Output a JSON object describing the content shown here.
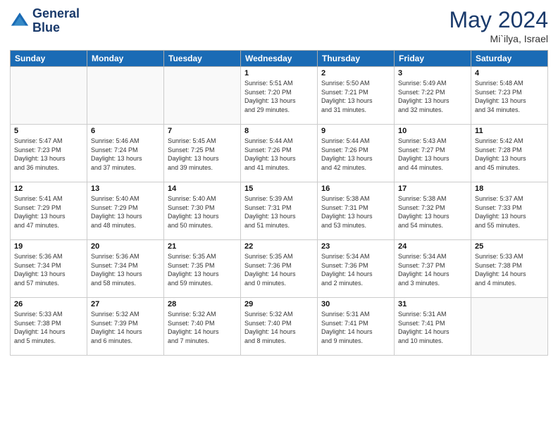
{
  "header": {
    "logo_line1": "General",
    "logo_line2": "Blue",
    "month": "May 2024",
    "location": "Mi`ilya, Israel"
  },
  "days_of_week": [
    "Sunday",
    "Monday",
    "Tuesday",
    "Wednesday",
    "Thursday",
    "Friday",
    "Saturday"
  ],
  "weeks": [
    [
      {
        "day": "",
        "info": ""
      },
      {
        "day": "",
        "info": ""
      },
      {
        "day": "",
        "info": ""
      },
      {
        "day": "1",
        "info": "Sunrise: 5:51 AM\nSunset: 7:20 PM\nDaylight: 13 hours\nand 29 minutes."
      },
      {
        "day": "2",
        "info": "Sunrise: 5:50 AM\nSunset: 7:21 PM\nDaylight: 13 hours\nand 31 minutes."
      },
      {
        "day": "3",
        "info": "Sunrise: 5:49 AM\nSunset: 7:22 PM\nDaylight: 13 hours\nand 32 minutes."
      },
      {
        "day": "4",
        "info": "Sunrise: 5:48 AM\nSunset: 7:23 PM\nDaylight: 13 hours\nand 34 minutes."
      }
    ],
    [
      {
        "day": "5",
        "info": "Sunrise: 5:47 AM\nSunset: 7:23 PM\nDaylight: 13 hours\nand 36 minutes."
      },
      {
        "day": "6",
        "info": "Sunrise: 5:46 AM\nSunset: 7:24 PM\nDaylight: 13 hours\nand 37 minutes."
      },
      {
        "day": "7",
        "info": "Sunrise: 5:45 AM\nSunset: 7:25 PM\nDaylight: 13 hours\nand 39 minutes."
      },
      {
        "day": "8",
        "info": "Sunrise: 5:44 AM\nSunset: 7:26 PM\nDaylight: 13 hours\nand 41 minutes."
      },
      {
        "day": "9",
        "info": "Sunrise: 5:44 AM\nSunset: 7:26 PM\nDaylight: 13 hours\nand 42 minutes."
      },
      {
        "day": "10",
        "info": "Sunrise: 5:43 AM\nSunset: 7:27 PM\nDaylight: 13 hours\nand 44 minutes."
      },
      {
        "day": "11",
        "info": "Sunrise: 5:42 AM\nSunset: 7:28 PM\nDaylight: 13 hours\nand 45 minutes."
      }
    ],
    [
      {
        "day": "12",
        "info": "Sunrise: 5:41 AM\nSunset: 7:29 PM\nDaylight: 13 hours\nand 47 minutes."
      },
      {
        "day": "13",
        "info": "Sunrise: 5:40 AM\nSunset: 7:29 PM\nDaylight: 13 hours\nand 48 minutes."
      },
      {
        "day": "14",
        "info": "Sunrise: 5:40 AM\nSunset: 7:30 PM\nDaylight: 13 hours\nand 50 minutes."
      },
      {
        "day": "15",
        "info": "Sunrise: 5:39 AM\nSunset: 7:31 PM\nDaylight: 13 hours\nand 51 minutes."
      },
      {
        "day": "16",
        "info": "Sunrise: 5:38 AM\nSunset: 7:31 PM\nDaylight: 13 hours\nand 53 minutes."
      },
      {
        "day": "17",
        "info": "Sunrise: 5:38 AM\nSunset: 7:32 PM\nDaylight: 13 hours\nand 54 minutes."
      },
      {
        "day": "18",
        "info": "Sunrise: 5:37 AM\nSunset: 7:33 PM\nDaylight: 13 hours\nand 55 minutes."
      }
    ],
    [
      {
        "day": "19",
        "info": "Sunrise: 5:36 AM\nSunset: 7:34 PM\nDaylight: 13 hours\nand 57 minutes."
      },
      {
        "day": "20",
        "info": "Sunrise: 5:36 AM\nSunset: 7:34 PM\nDaylight: 13 hours\nand 58 minutes."
      },
      {
        "day": "21",
        "info": "Sunrise: 5:35 AM\nSunset: 7:35 PM\nDaylight: 13 hours\nand 59 minutes."
      },
      {
        "day": "22",
        "info": "Sunrise: 5:35 AM\nSunset: 7:36 PM\nDaylight: 14 hours\nand 0 minutes."
      },
      {
        "day": "23",
        "info": "Sunrise: 5:34 AM\nSunset: 7:36 PM\nDaylight: 14 hours\nand 2 minutes."
      },
      {
        "day": "24",
        "info": "Sunrise: 5:34 AM\nSunset: 7:37 PM\nDaylight: 14 hours\nand 3 minutes."
      },
      {
        "day": "25",
        "info": "Sunrise: 5:33 AM\nSunset: 7:38 PM\nDaylight: 14 hours\nand 4 minutes."
      }
    ],
    [
      {
        "day": "26",
        "info": "Sunrise: 5:33 AM\nSunset: 7:38 PM\nDaylight: 14 hours\nand 5 minutes."
      },
      {
        "day": "27",
        "info": "Sunrise: 5:32 AM\nSunset: 7:39 PM\nDaylight: 14 hours\nand 6 minutes."
      },
      {
        "day": "28",
        "info": "Sunrise: 5:32 AM\nSunset: 7:40 PM\nDaylight: 14 hours\nand 7 minutes."
      },
      {
        "day": "29",
        "info": "Sunrise: 5:32 AM\nSunset: 7:40 PM\nDaylight: 14 hours\nand 8 minutes."
      },
      {
        "day": "30",
        "info": "Sunrise: 5:31 AM\nSunset: 7:41 PM\nDaylight: 14 hours\nand 9 minutes."
      },
      {
        "day": "31",
        "info": "Sunrise: 5:31 AM\nSunset: 7:41 PM\nDaylight: 14 hours\nand 10 minutes."
      },
      {
        "day": "",
        "info": ""
      }
    ]
  ]
}
